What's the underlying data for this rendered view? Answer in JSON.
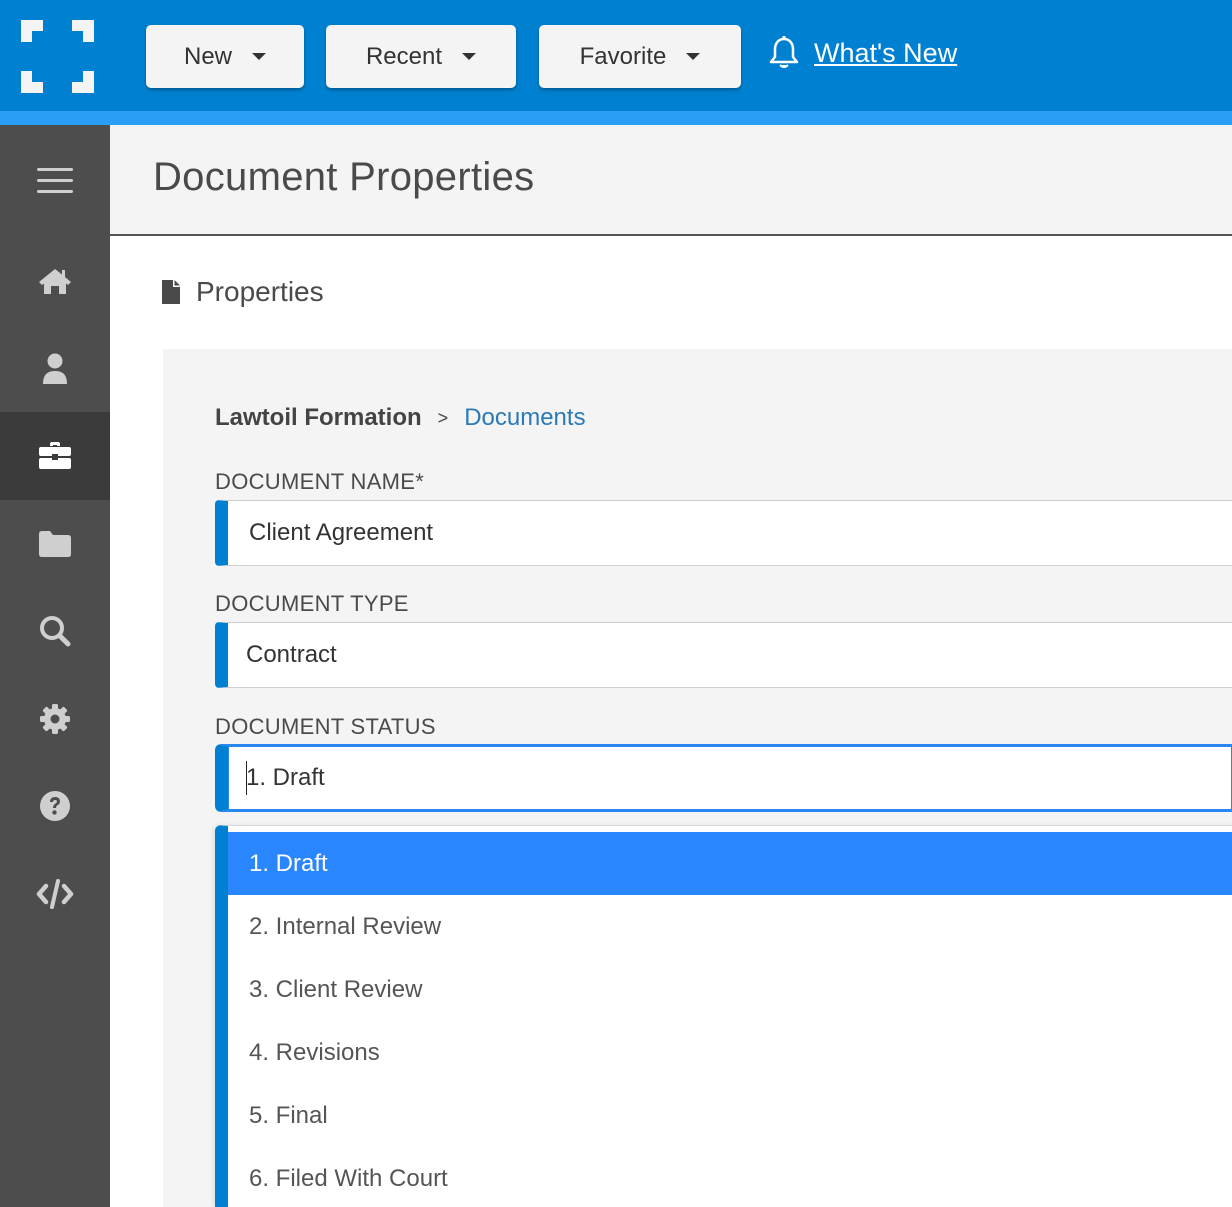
{
  "topbar": {
    "logo": "bracket-logo-icon",
    "buttons": [
      {
        "label": "New",
        "icon": "caret-down-icon"
      },
      {
        "label": "Recent",
        "icon": "caret-down-icon"
      },
      {
        "label": "Favorite",
        "icon": "caret-down-icon"
      }
    ],
    "whats_new": {
      "label": "What's New",
      "icon": "bell-icon"
    },
    "colors": {
      "primary": "#0080d0",
      "accent": "#2a9df4"
    }
  },
  "sidebar": {
    "items": [
      {
        "icon": "menu-icon",
        "active": false
      },
      {
        "icon": "home-icon",
        "active": false
      },
      {
        "icon": "user-icon",
        "active": false
      },
      {
        "icon": "briefcase-icon",
        "active": true
      },
      {
        "icon": "folder-icon",
        "active": false
      },
      {
        "icon": "search-icon",
        "active": false
      },
      {
        "icon": "gear-icon",
        "active": false
      },
      {
        "icon": "help-icon",
        "active": false
      },
      {
        "icon": "code-icon",
        "active": false
      }
    ]
  },
  "header": {
    "title": "Document Properties"
  },
  "section": {
    "title": "Properties",
    "icon": "document-icon"
  },
  "breadcrumb": {
    "root": "Lawtoil Formation",
    "separator": ">",
    "current": "Documents"
  },
  "form": {
    "document_name": {
      "label": "DOCUMENT NAME*",
      "value": "Client Agreement"
    },
    "document_type": {
      "label": "DOCUMENT TYPE",
      "value": "Contract"
    },
    "document_status": {
      "label": "DOCUMENT STATUS",
      "value": "1. Draft",
      "options": [
        {
          "label": "1. Draft",
          "selected": true
        },
        {
          "label": "2. Internal Review",
          "selected": false
        },
        {
          "label": "3. Client Review",
          "selected": false
        },
        {
          "label": "4. Revisions",
          "selected": false
        },
        {
          "label": "5. Final",
          "selected": false
        },
        {
          "label": "6. Filed With Court",
          "selected": false
        }
      ]
    }
  }
}
